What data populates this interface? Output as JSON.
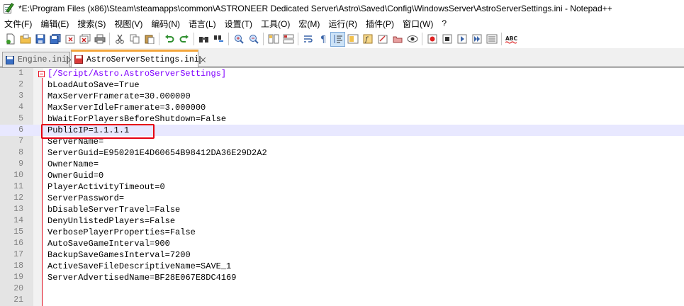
{
  "window": {
    "title": "*E:\\Program Files (x86)\\Steam\\steamapps\\common\\ASTRONEER Dedicated Server\\Astro\\Saved\\Config\\WindowsServer\\AstroServerSettings.ini - Notepad++"
  },
  "menu": [
    {
      "label": "文件(F)"
    },
    {
      "label": "编辑(E)"
    },
    {
      "label": "搜索(S)"
    },
    {
      "label": "视图(V)"
    },
    {
      "label": "编码(N)"
    },
    {
      "label": "语言(L)"
    },
    {
      "label": "设置(T)"
    },
    {
      "label": "工具(O)"
    },
    {
      "label": "宏(M)"
    },
    {
      "label": "运行(R)"
    },
    {
      "label": "插件(P)"
    },
    {
      "label": "窗口(W)"
    },
    {
      "label": "?"
    }
  ],
  "toolbar": {
    "icons": [
      "new-file-icon",
      "open-file-icon",
      "save-icon",
      "save-all-icon",
      "close-icon",
      "close-all-icon",
      "print-icon",
      "cut-icon",
      "copy-icon",
      "paste-icon",
      "undo-icon",
      "redo-icon",
      "find-icon",
      "replace-icon",
      "zoom-in-icon",
      "zoom-out-icon",
      "sync-vertical-icon",
      "sync-horizontal-icon",
      "word-wrap-icon",
      "show-all-chars-icon",
      "indent-guide-icon",
      "doc-map-icon",
      "function-list-icon",
      "folder-workspace-icon",
      "monitoring-icon",
      "record-macro-icon",
      "stop-record-icon",
      "play-macro-icon",
      "run-macro-multiple-icon",
      "save-macro-icon",
      "spell-check-icon"
    ],
    "spell_label": "ABC"
  },
  "tabs": [
    {
      "label": "Engine.ini",
      "active": false
    },
    {
      "label": "AstroServerSettings.ini",
      "active": true
    }
  ],
  "editor": {
    "section_header": "[/Script/Astro.AstroServerSettings]",
    "lines": [
      {
        "num": "1",
        "key": "",
        "eq": "",
        "value": ""
      },
      {
        "num": "2",
        "key": "bLoadAutoSave",
        "eq": "=",
        "value": "True"
      },
      {
        "num": "3",
        "key": "MaxServerFramerate",
        "eq": "=",
        "value": "30.000000"
      },
      {
        "num": "4",
        "key": "MaxServerIdleFramerate",
        "eq": "=",
        "value": "3.000000"
      },
      {
        "num": "5",
        "key": "bWaitForPlayersBeforeShutdown",
        "eq": "=",
        "value": "False"
      },
      {
        "num": "6",
        "key": "PublicIP",
        "eq": "=",
        "value": "1.1.1.1"
      },
      {
        "num": "7",
        "key": "ServerName",
        "eq": "=",
        "value": ""
      },
      {
        "num": "8",
        "key": "ServerGuid",
        "eq": "=",
        "value": "E950201E4D60654B98412DA36E29D2A2"
      },
      {
        "num": "9",
        "key": "OwnerName",
        "eq": "=",
        "value": ""
      },
      {
        "num": "10",
        "key": "OwnerGuid",
        "eq": "=",
        "value": "0"
      },
      {
        "num": "11",
        "key": "PlayerActivityTimeout",
        "eq": "=",
        "value": "0"
      },
      {
        "num": "12",
        "key": "ServerPassword",
        "eq": "=",
        "value": ""
      },
      {
        "num": "13",
        "key": "bDisableServerTravel",
        "eq": "=",
        "value": "False"
      },
      {
        "num": "14",
        "key": "DenyUnlistedPlayers",
        "eq": "=",
        "value": "False"
      },
      {
        "num": "15",
        "key": "VerbosePlayerProperties",
        "eq": "=",
        "value": "False"
      },
      {
        "num": "16",
        "key": "AutoSaveGameInterval",
        "eq": "=",
        "value": "900"
      },
      {
        "num": "17",
        "key": "BackupSaveGamesInterval",
        "eq": "=",
        "value": "7200"
      },
      {
        "num": "18",
        "key": "ActiveSaveFileDescriptiveName",
        "eq": "=",
        "value": "SAVE_1"
      },
      {
        "num": "19",
        "key": "ServerAdvertisedName",
        "eq": "=",
        "value": "BF28E067E8DC4169"
      },
      {
        "num": "20",
        "key": "",
        "eq": "",
        "value": ""
      },
      {
        "num": "21",
        "key": "",
        "eq": "",
        "value": ""
      }
    ],
    "current_line": 6
  }
}
